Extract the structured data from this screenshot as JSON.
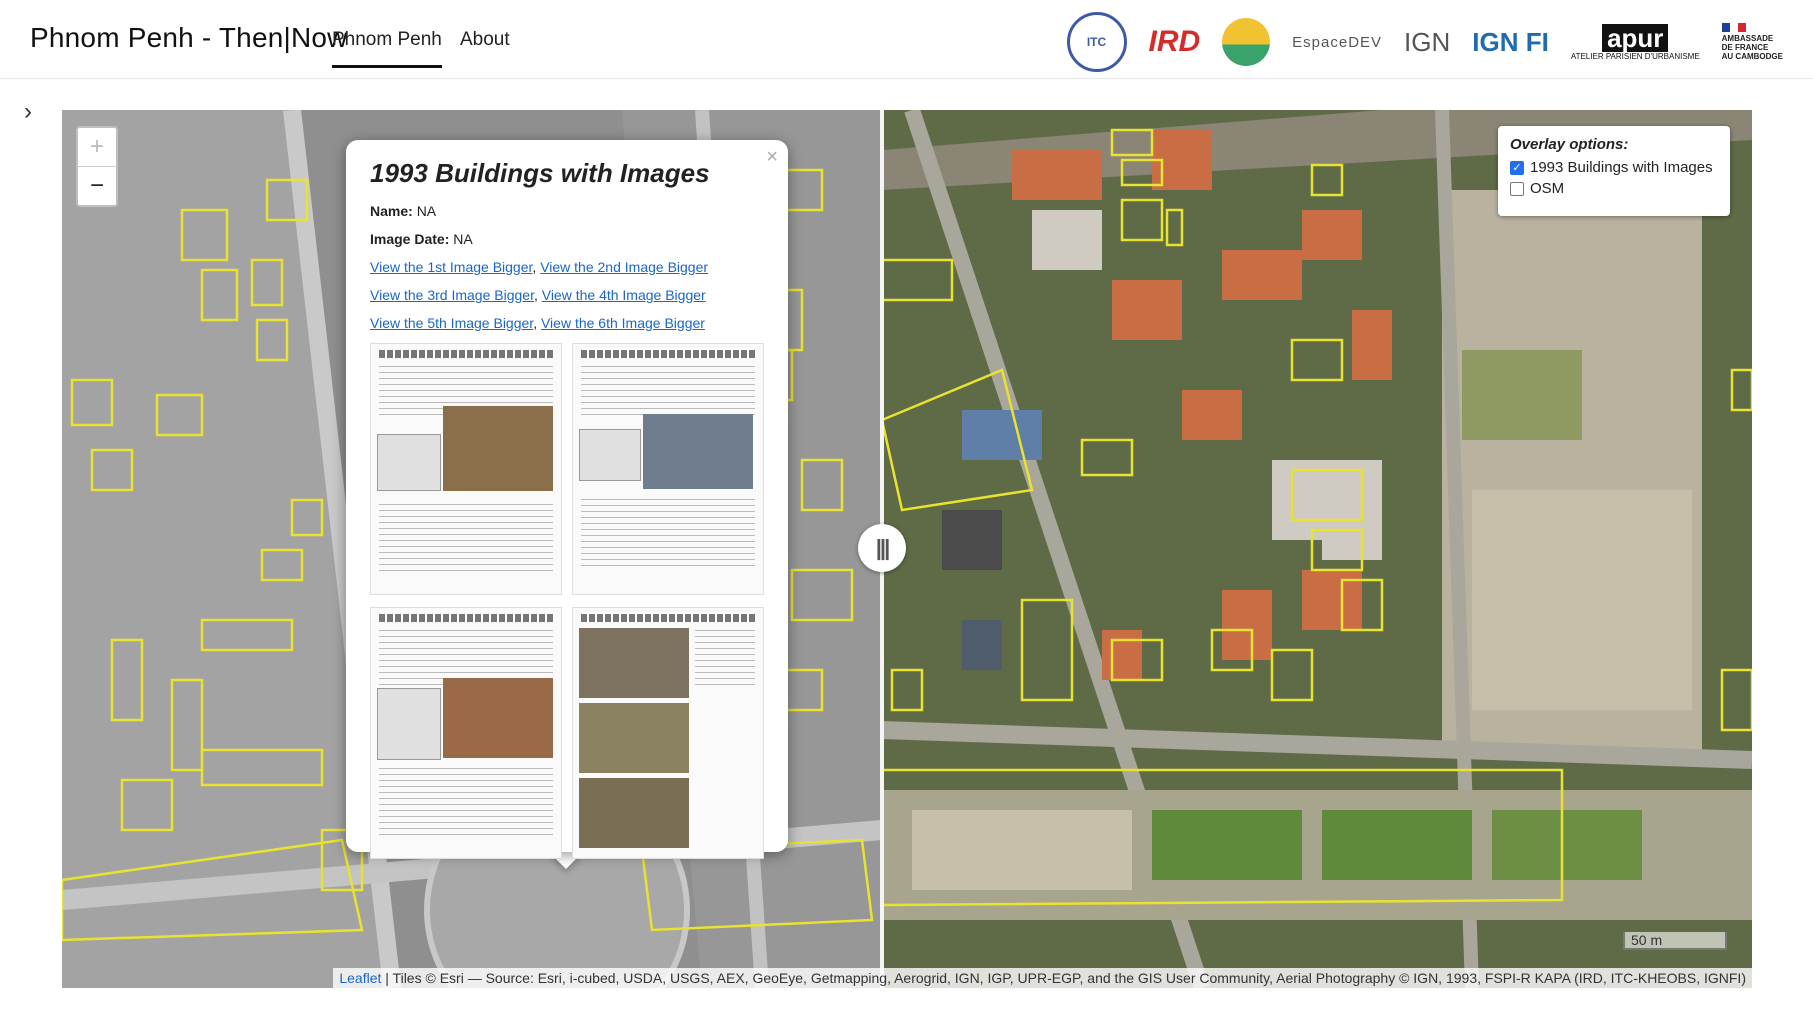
{
  "header": {
    "title": "Phnom Penh - Then|Now",
    "nav": [
      {
        "label": "Phnom Penh",
        "active": true
      },
      {
        "label": "About",
        "active": false
      }
    ],
    "logos": {
      "itc": "ITC",
      "ird_big": "IRD",
      "espace_big": "EspaceDEV",
      "ign_big": "IGN",
      "ignfi": "IGN FI",
      "apur_big": "apur",
      "apur_small": "ATELIER PARISIEN D'URBANISME",
      "amb_lines": [
        "AMBASSADE",
        "DE FRANCE",
        "AU CAMBODGE"
      ]
    }
  },
  "sidebar": {
    "toggle_icon": "chevron-right-icon",
    "toggle_glyph": "›"
  },
  "map": {
    "zoom_in": "+",
    "zoom_out": "−",
    "divider_glyph": "|||",
    "overlay": {
      "title": "Overlay options:",
      "options": [
        {
          "label": "1993 Buildings with Images",
          "checked": true
        },
        {
          "label": "OSM",
          "checked": false
        }
      ]
    },
    "popup": {
      "close": "×",
      "title": "1993 Buildings with Images",
      "name_label": "Name:",
      "name_value": "NA",
      "date_label": "Image Date:",
      "date_value": "NA",
      "links": [
        "View the 1st Image Bigger",
        "View the 2nd Image Bigger",
        "View the 3rd Image Bigger",
        "View the 4th Image Bigger",
        "View the 5th Image Bigger",
        "View the 6th Image Bigger"
      ]
    },
    "scale": "50 m",
    "attribution": {
      "link": "Leaflet",
      "text": " | Tiles © Esri — Source: Esri, i-cubed, USDA, USGS, AEX, GeoEye, Getmapping, Aerogrid, IGN, IGP, UPR-EGP, and the GIS User Community, Aerial Photography © IGN, 1993, FSPI-R KAPA (IRD, ITC-KHEOBS, IGNFI)"
    },
    "colors": {
      "overlay_outline": "#e8e230",
      "link": "#1a66c8",
      "checkbox": "#1f6ff0"
    }
  }
}
